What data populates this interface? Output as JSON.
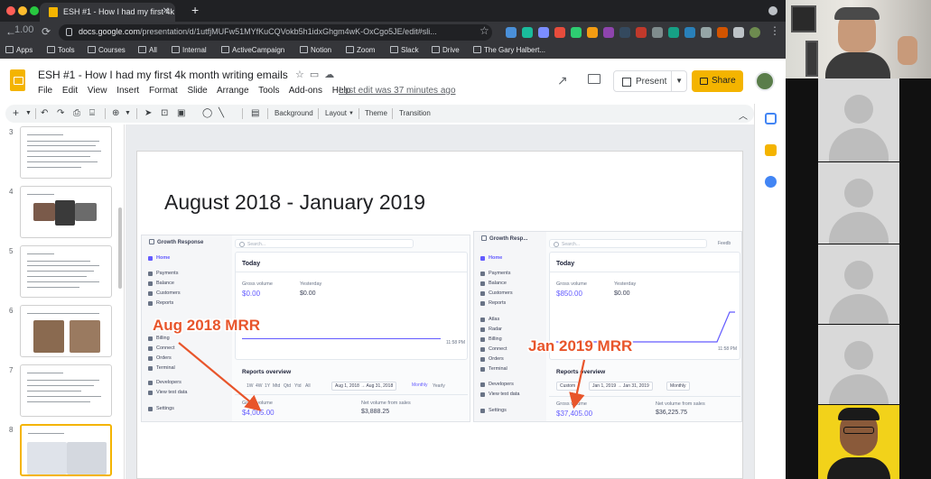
{
  "browser": {
    "tab_title": "ESH #1 - How I had my first 4k",
    "back_overlay_text": "1.00",
    "url_host": "docs.google.com",
    "url_path": "/presentation/d/1utfjMUFw51MYfKuCQVokb5h1idxGhgm4wK-OxCgo5JE/edit#sli...",
    "bookmarks": [
      "Apps",
      "Tools",
      "Courses",
      "All",
      "Internal",
      "ActiveCampaign",
      "Notion",
      "Zoom",
      "Slack",
      "Drive",
      "The Gary Halbert..."
    ],
    "colors": {
      "tabbar": "#202124",
      "toolbar": "#35363a"
    }
  },
  "slides": {
    "doc_title": "ESH #1 - How I had my first 4k month writing emails",
    "menu": [
      "File",
      "Edit",
      "View",
      "Insert",
      "Format",
      "Slide",
      "Arrange",
      "Tools",
      "Add-ons",
      "Help"
    ],
    "last_edit": "Last edit was 37 minutes ago",
    "present_label": "Present",
    "share_label": "Share",
    "toolbar": {
      "background": "Background",
      "layout": "Layout",
      "theme": "Theme",
      "transition": "Transition"
    },
    "thumbnails": [
      {
        "num": "3"
      },
      {
        "num": "4"
      },
      {
        "num": "5"
      },
      {
        "num": "6"
      },
      {
        "num": "7"
      },
      {
        "num": "8"
      }
    ],
    "current_slide": {
      "title": "August 2018 - January 2019"
    },
    "accent_color": "#f4b400"
  },
  "stripe_left": {
    "account": "Growth Response",
    "search": "Search...",
    "nav": [
      "Home",
      "Payments",
      "Balance",
      "Customers",
      "Reports",
      "Billing",
      "Connect",
      "Orders",
      "Terminal",
      "Developers",
      "View test data",
      "Settings"
    ],
    "today": "Today",
    "gross_volume_label": "Gross volume",
    "gross_volume_today": "$0.00",
    "yesterday_label": "Yesterday",
    "yesterday_value": "$0.00",
    "time_label": "11:58 PM",
    "reports_overview": "Reports overview",
    "ranges": [
      "1W",
      "4W",
      "1Y",
      "Mtd",
      "Qtd",
      "Ytd",
      "All"
    ],
    "date_range": "Aug 1, 2018 → Aug 31, 2018",
    "monthly": "Monthly",
    "yearly": "Yearly",
    "gross_volume_period": "$4,005.00",
    "net_volume_label": "Net volume from sales",
    "net_volume_period": "$3,888.25"
  },
  "stripe_right": {
    "account": "Growth Resp...",
    "search": "Search...",
    "feedback": "Feedb",
    "nav": [
      "Home",
      "Payments",
      "Balance",
      "Customers",
      "Reports",
      "Atlas",
      "Radar",
      "Billing",
      "Connect",
      "Orders",
      "Terminal",
      "Developers",
      "View test data",
      "Settings"
    ],
    "today": "Today",
    "gross_volume_label": "Gross volume",
    "gross_volume_today": "$850.00",
    "yesterday_label": "Yesterday",
    "yesterday_value": "$0.00",
    "time_label": "11:58 PM",
    "reports_overview": "Reports overview",
    "custom": "Custom",
    "date_range": "Jan 1, 2019 → Jan 31, 2019",
    "monthly": "Monthly",
    "gross_volume_period": "$37,405.00",
    "net_volume_label": "Net volume from sales",
    "net_volume_period": "$36,225.75"
  },
  "annotations": {
    "aug": "Aug 2018 MRR",
    "jan": "Jan 2019 MRR",
    "color": "#e8552b"
  }
}
